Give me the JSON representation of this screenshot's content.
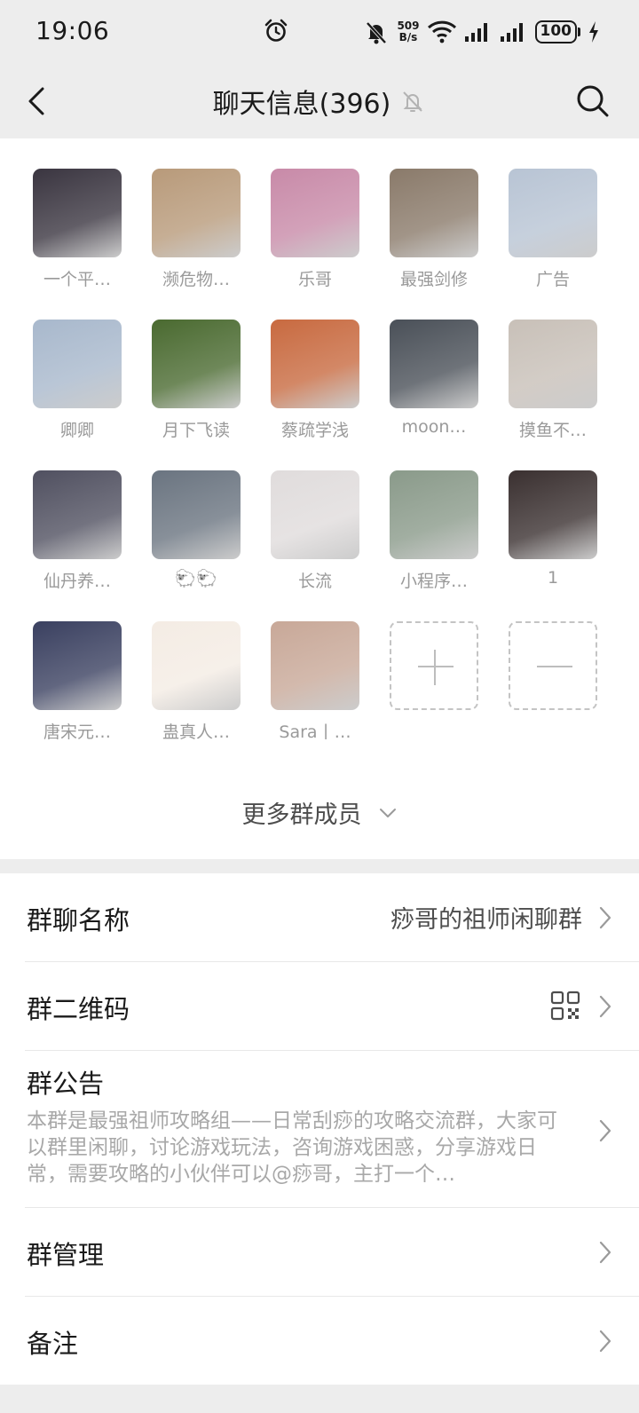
{
  "status_bar": {
    "time": "19:06",
    "net_speed_value": "509",
    "net_speed_unit": "B/s",
    "battery": "100"
  },
  "header": {
    "title": "聊天信息(396)",
    "icons": [
      "back-arrow-icon",
      "mute-bell-icon",
      "search-icon"
    ]
  },
  "members": [
    {
      "name": "一个平…",
      "avatar_color": "#3a3540"
    },
    {
      "name": "濒危物…",
      "avatar_color": "#b89a7a"
    },
    {
      "name": "乐哥",
      "avatar_color": "#c88aa8"
    },
    {
      "name": "最强剑修",
      "avatar_color": "#8a7a6a"
    },
    {
      "name": "广告",
      "avatar_color": "#b8c4d4"
    },
    {
      "name": "卿卿",
      "avatar_color": "#a8b8cc"
    },
    {
      "name": "月下飞读",
      "avatar_color": "#4a6a30"
    },
    {
      "name": "蔡疏学浅",
      "avatar_color": "#c86a40"
    },
    {
      "name": "moon…",
      "avatar_color": "#4a5058"
    },
    {
      "name": "摸鱼不…",
      "avatar_color": "#c8c0b8"
    },
    {
      "name": "仙丹养…",
      "avatar_color": "#505060"
    },
    {
      "name": "🐑🐑",
      "avatar_color": "#6a7480"
    },
    {
      "name": "长流",
      "avatar_color": "#e0dcdc"
    },
    {
      "name": "小程序…",
      "avatar_color": "#8a9a8a"
    },
    {
      "name": "1",
      "avatar_color": "#3a3030"
    },
    {
      "name": "唐宋元…",
      "avatar_color": "#3a4060"
    },
    {
      "name": "蛊真人…",
      "avatar_color": "#f4ece4"
    },
    {
      "name": "Sara丨…",
      "avatar_color": "#c8a898"
    }
  ],
  "add_member_label": "",
  "more_members_label": "更多群成员",
  "settings": {
    "group_name_label": "群聊名称",
    "group_name_value": "痧哥的祖师闲聊群",
    "qr_code_label": "群二维码",
    "notice_label": "群公告",
    "notice_text": "本群是最强祖师攻略组——日常刮痧的攻略交流群，大家可以群里闲聊，讨论游戏玩法，咨询游戏困惑，分享游戏日常，需要攻略的小伙伴可以@痧哥，主打一个…",
    "manage_label": "群管理",
    "remark_label": "备注"
  }
}
